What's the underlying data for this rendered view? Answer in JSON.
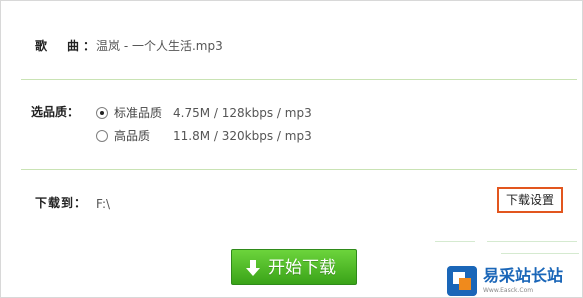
{
  "song": {
    "label": "歌　曲：",
    "value": "温岚 - 一个人生活.mp3"
  },
  "quality": {
    "label": "选品质：",
    "options": [
      {
        "label": "标准品质",
        "detail": "4.75M / 128kbps / mp3",
        "selected": true
      },
      {
        "label": "高品质",
        "detail": "11.8M / 320kbps / mp3",
        "selected": false
      }
    ]
  },
  "download": {
    "label": "下载到：",
    "path": "F:\\",
    "settings_label": "下载设置",
    "start_label": "开始下载"
  },
  "watermark": {
    "text": "易采站长站",
    "sub": "Www.Easck.Com"
  },
  "colors": {
    "accent_green": "#3aa318",
    "divider": "#c9e3b4",
    "highlight_border": "#e2561e",
    "watermark_blue": "#1a66b8"
  },
  "icons": {
    "start": "download-arrow-icon"
  }
}
